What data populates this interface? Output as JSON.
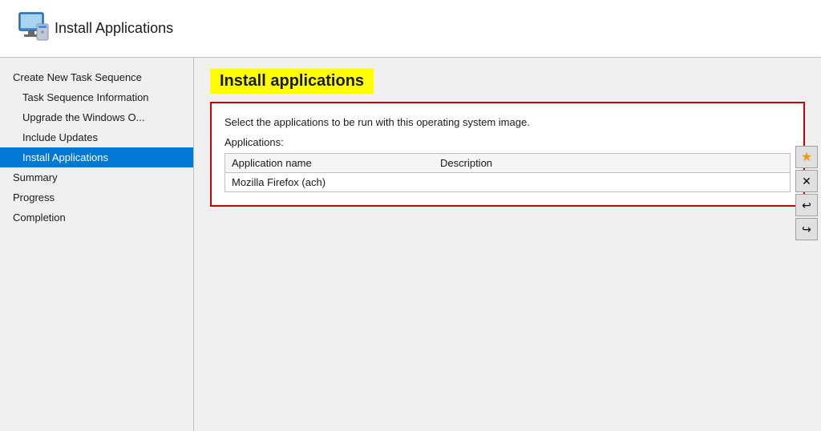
{
  "header": {
    "title": "Install Applications",
    "icon_label": "computer-icon"
  },
  "sidebar": {
    "items": [
      {
        "id": "create-task",
        "label": "Create New Task Sequence",
        "indent": 0,
        "active": false
      },
      {
        "id": "task-seq-info",
        "label": "Task Sequence Information",
        "indent": 1,
        "active": false
      },
      {
        "id": "upgrade-windows",
        "label": "Upgrade the Windows O...",
        "indent": 1,
        "active": false
      },
      {
        "id": "include-updates",
        "label": "Include Updates",
        "indent": 1,
        "active": false
      },
      {
        "id": "install-apps",
        "label": "Install Applications",
        "indent": 1,
        "active": true
      },
      {
        "id": "summary",
        "label": "Summary",
        "indent": 0,
        "active": false
      },
      {
        "id": "progress",
        "label": "Progress",
        "indent": 0,
        "active": false
      },
      {
        "id": "completion",
        "label": "Completion",
        "indent": 0,
        "active": false
      }
    ]
  },
  "content": {
    "page_title": "Install applications",
    "description": "Select the applications to be run with this operating system image.",
    "applications_label": "Applications:",
    "table": {
      "columns": [
        {
          "id": "name",
          "label": "Application name"
        },
        {
          "id": "desc",
          "label": "Description"
        }
      ],
      "rows": [
        {
          "name": "Mozilla Firefox (ach)",
          "description": ""
        }
      ]
    }
  },
  "toolbar": {
    "buttons": [
      {
        "id": "star-btn",
        "icon": "★",
        "icon_class": "star",
        "label": "star-button"
      },
      {
        "id": "remove-btn",
        "icon": "✕",
        "label": "remove-button"
      },
      {
        "id": "move-up-btn",
        "icon": "↩",
        "label": "move-up-button"
      },
      {
        "id": "move-down-btn",
        "icon": "↪",
        "label": "move-down-button"
      }
    ]
  }
}
